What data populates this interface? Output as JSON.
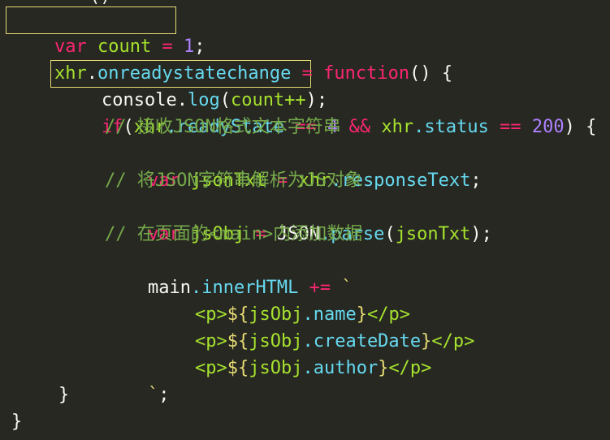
{
  "top_partial": "()",
  "lines": {
    "l1": {
      "kw": "var",
      "name": "count",
      "op": " = ",
      "num": "1",
      "end": ";"
    },
    "l2": {
      "obj": "xhr",
      "dot": ".",
      "prop": "onreadystatechange",
      "op": " = ",
      "kw": "function",
      "rest": "() {"
    },
    "l3": {
      "obj": "console",
      "dot": ".",
      "fn": "log",
      "open": "(",
      "arg": "count++",
      "close": ");"
    },
    "l4": {
      "kw": "if",
      "open": "(",
      "obj1": "xhr",
      "prop1": ".readyState",
      "op1": " == ",
      "num1": "4",
      "and": " && ",
      "obj2": "xhr",
      "prop2": ".status",
      "op2": " == ",
      "num2": "200",
      "close": ") {"
    },
    "l5": {
      "comment": "// 接收JSON格式文本字符串"
    },
    "l6": {
      "kw": "var",
      "name": "jsonTxt",
      "op": " = ",
      "obj": "xhr",
      "prop": ".responseText",
      "end": ";"
    },
    "l7": {
      "comment": "// 将JSON字符串解析为JS对象"
    },
    "l8": {
      "kw": "var",
      "name": "jsObj",
      "op": " = ",
      "obj": "JSON",
      "fn": ".parse",
      "open": "(",
      "arg": "jsonTxt",
      "close": ");"
    },
    "l9": {
      "comment": "// 在页面的<main>内添加数据"
    },
    "l10": {
      "obj": "main",
      "prop": ".innerHTML",
      "op": " += ",
      "tick": "`"
    },
    "l11": {
      "open": "<p>",
      "expr_open": "${",
      "obj": "jsObj",
      "prop": ".name",
      "expr_close": "}",
      "close": "</p>"
    },
    "l12": {
      "open": "<p>",
      "expr_open": "${",
      "obj": "jsObj",
      "prop": ".createDate",
      "expr_close": "}",
      "close": "</p>"
    },
    "l13": {
      "open": "<p>",
      "expr_open": "${",
      "obj": "jsObj",
      "prop": ".author",
      "expr_close": "}",
      "close": "</p>"
    },
    "l14": {
      "tick": "`",
      "end": ";"
    },
    "l15": {
      "brace": "}"
    },
    "l16": {
      "brace": "}"
    }
  },
  "colors": {
    "background": "#272822",
    "highlight_border": "#e6db74"
  }
}
